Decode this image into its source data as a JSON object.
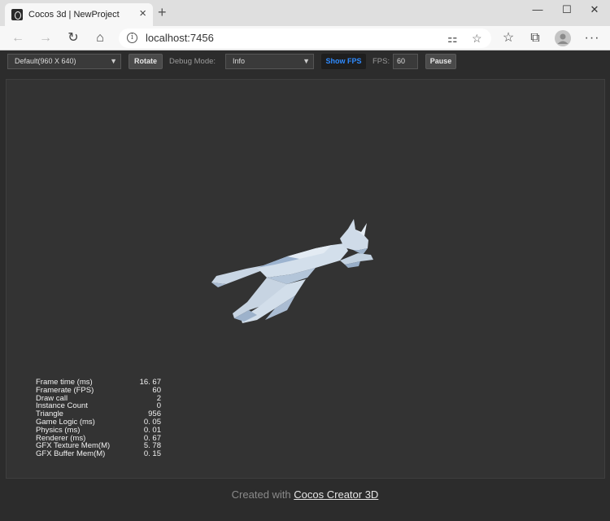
{
  "browser": {
    "tab_title": "Cocos 3d | NewProject",
    "tab_close": "×",
    "new_tab": "+",
    "window_controls": {
      "minimize": "—",
      "maximize": "☐",
      "close": "✕"
    },
    "nav": {
      "back": "←",
      "forward": "→",
      "refresh": "↻",
      "home": "⌂"
    },
    "url": "localhost:7456",
    "info_glyph": "i",
    "url_icons": {
      "immersive_reader": "⚏",
      "favorite": "☆"
    },
    "toolbar_icons": {
      "favorites": "☆",
      "collections": "⧉",
      "more": "···"
    }
  },
  "toolbar": {
    "resolution_select": "Default(960 X 640)",
    "rotate_label": "Rotate",
    "debug_mode_label": "Debug Mode:",
    "debug_mode_select": "Info",
    "show_fps_label": "Show FPS",
    "fps_label": "FPS:",
    "fps_value": "60",
    "pause_label": "Pause"
  },
  "stats": [
    {
      "label": "Frame time (ms)",
      "value": "16. 67"
    },
    {
      "label": "Framerate (FPS)",
      "value": "60"
    },
    {
      "label": "Draw call",
      "value": "2"
    },
    {
      "label": "Instance Count",
      "value": "0"
    },
    {
      "label": "Triangle",
      "value": "956"
    },
    {
      "label": "Game Logic (ms)",
      "value": "0. 05"
    },
    {
      "label": "Physics (ms)",
      "value": "0. 01"
    },
    {
      "label": "Renderer (ms)",
      "value": "0. 67"
    },
    {
      "label": "GFX Texture Mem(M)",
      "value": "5. 78"
    },
    {
      "label": "GFX Buffer Mem(M)",
      "value": "0. 15"
    }
  ],
  "footer": {
    "prefix": "Created with",
    "link": "Cocos Creator 3D"
  },
  "colors": {
    "canvas_bg": "#333333",
    "accent_blue": "#2f8bff",
    "model_light": "#d6e2ee",
    "model_shadow": "#8ea6c2"
  }
}
